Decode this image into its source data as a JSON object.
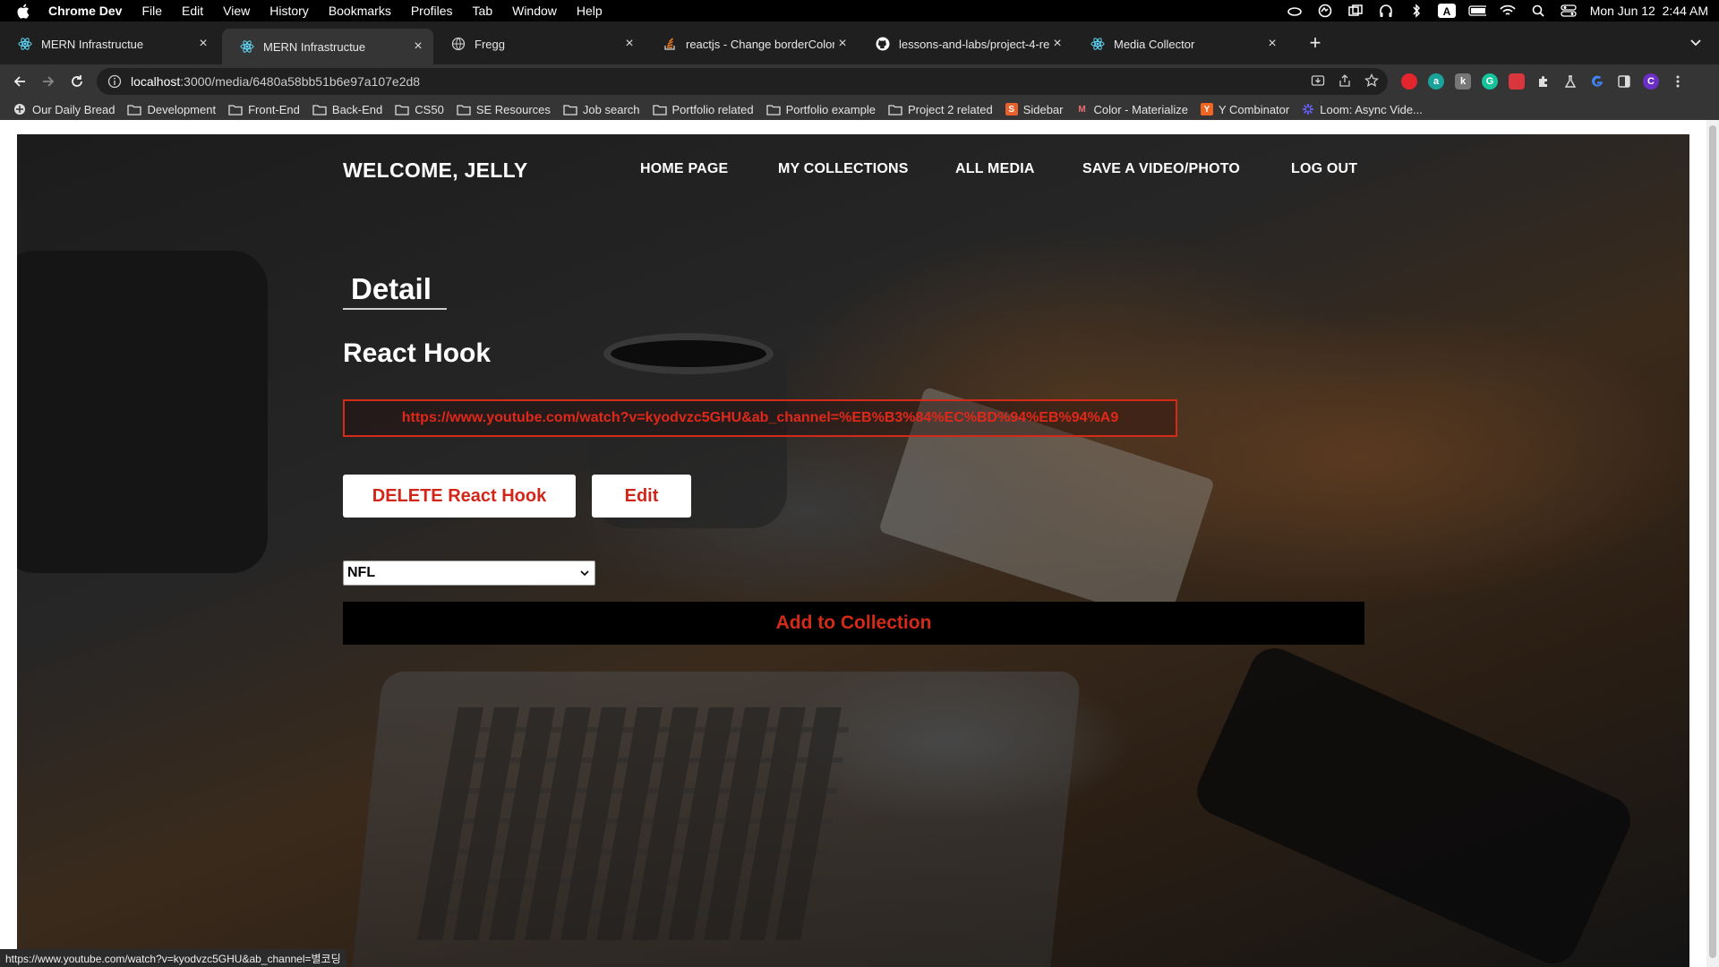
{
  "menubar": {
    "app_name": "Chrome Dev",
    "items": [
      "File",
      "Edit",
      "View",
      "History",
      "Bookmarks",
      "Profiles",
      "Tab",
      "Window",
      "Help"
    ],
    "datetime": "Mon Jun 12  2:44 AM"
  },
  "tabs": [
    {
      "title": "MERN Infrastructue",
      "icon": "react-icon",
      "active": false
    },
    {
      "title": "MERN Infrastructue",
      "icon": "react-icon",
      "active": true
    },
    {
      "title": "Fregg",
      "icon": "globe-icon",
      "active": false
    },
    {
      "title": "reactjs - Change borderColor i",
      "icon": "stackoverflow-icon",
      "active": false
    },
    {
      "title": "lessons-and-labs/project-4-re",
      "icon": "github-icon",
      "active": false
    },
    {
      "title": "Media Collector",
      "icon": "react-icon",
      "active": false
    }
  ],
  "omnibox": {
    "host": "localhost",
    "path": ":3000/media/6480a58bb51b6e97a107e2d8"
  },
  "bookmarks": [
    {
      "label": "Our Daily Bread",
      "icon": "site-icon"
    },
    {
      "label": "Development",
      "icon": "folder-icon"
    },
    {
      "label": "Front-End",
      "icon": "folder-icon"
    },
    {
      "label": "Back-End",
      "icon": "folder-icon"
    },
    {
      "label": "CS50",
      "icon": "folder-icon"
    },
    {
      "label": "SE Resources",
      "icon": "folder-icon"
    },
    {
      "label": "Job search",
      "icon": "folder-icon"
    },
    {
      "label": "Portfolio related",
      "icon": "folder-icon"
    },
    {
      "label": "Portfolio example",
      "icon": "folder-icon"
    },
    {
      "label": "Project 2 related",
      "icon": "folder-icon"
    },
    {
      "label": "Sidebar",
      "icon": "sidebar-site-icon"
    },
    {
      "label": "Color - Materialize",
      "icon": "materialize-icon"
    },
    {
      "label": "Y Combinator",
      "icon": "ycombinator-icon"
    },
    {
      "label": "Loom: Async Vide...",
      "icon": "loom-icon"
    }
  ],
  "page": {
    "welcome": "WELCOME, JELLY",
    "nav": [
      "HOME PAGE",
      "MY COLLECTIONS",
      "ALL MEDIA",
      "SAVE A VIDEO/PHOTO",
      "LOG OUT"
    ],
    "detail_heading": "Detail",
    "media_title": "React Hook",
    "media_url": "https://www.youtube.com/watch?v=kyodvzc5GHU&ab_channel=%EB%B3%84%EC%BD%94%EB%94%A9",
    "delete_label": "DELETE React Hook",
    "edit_label": "Edit",
    "collection_selected": "NFL",
    "add_label": "Add to Collection"
  },
  "status_url": "https://www.youtube.com/watch?v=kyodvzc5GHU&ab_channel=별코딩",
  "colors": {
    "accent_red": "#d42a1a"
  }
}
